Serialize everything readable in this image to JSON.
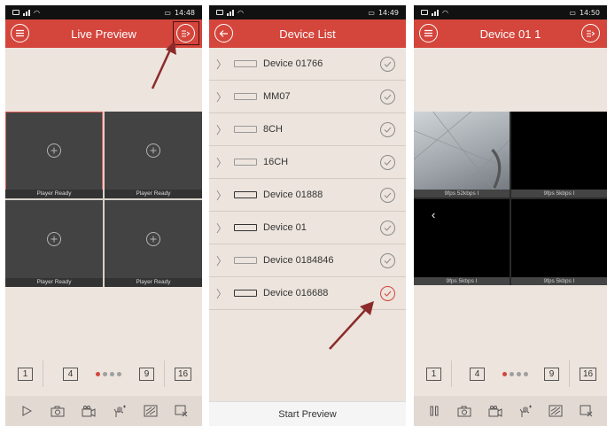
{
  "panel1": {
    "status": {
      "time": "14:48"
    },
    "title": "Live Preview",
    "cells": [
      "Player Ready",
      "Player Ready",
      "Player Ready",
      "Player Ready"
    ],
    "layout_buttons": [
      "1",
      "4",
      "9",
      "16"
    ]
  },
  "panel2": {
    "status": {
      "time": "14:49"
    },
    "title": "Device List",
    "devices": [
      {
        "name": "Device 01766",
        "online": false,
        "selected": false
      },
      {
        "name": "MM07",
        "online": false,
        "selected": false
      },
      {
        "name": "8CH",
        "online": false,
        "selected": false
      },
      {
        "name": "16CH",
        "online": false,
        "selected": false
      },
      {
        "name": "Device 01888",
        "online": true,
        "selected": false
      },
      {
        "name": "Device 01",
        "online": true,
        "selected": false
      },
      {
        "name": "Device 0184846",
        "online": false,
        "selected": false
      },
      {
        "name": "Device 016688",
        "online": true,
        "selected": true
      }
    ],
    "start_label": "Start Preview"
  },
  "panel3": {
    "status": {
      "time": "14:50"
    },
    "title": "Device 01 1",
    "cells": [
      "9fps 52kbps I",
      "9fps 5kbps I",
      "9fps 5kbps I",
      "9fps 5kbps I"
    ],
    "layout_buttons": [
      "1",
      "4",
      "9",
      "16"
    ]
  },
  "colors": {
    "accent": "#d4453c",
    "background": "#ece4dd",
    "arrow": "#8b2a2a"
  },
  "icons": [
    "menu-icon",
    "channel-list-icon",
    "back-icon",
    "play-icon",
    "pause-icon",
    "snapshot-icon",
    "record-icon",
    "ptz-icon",
    "quality-icon",
    "close-window-icon",
    "check-icon",
    "chevron-right-icon",
    "dvr-device-icon"
  ]
}
